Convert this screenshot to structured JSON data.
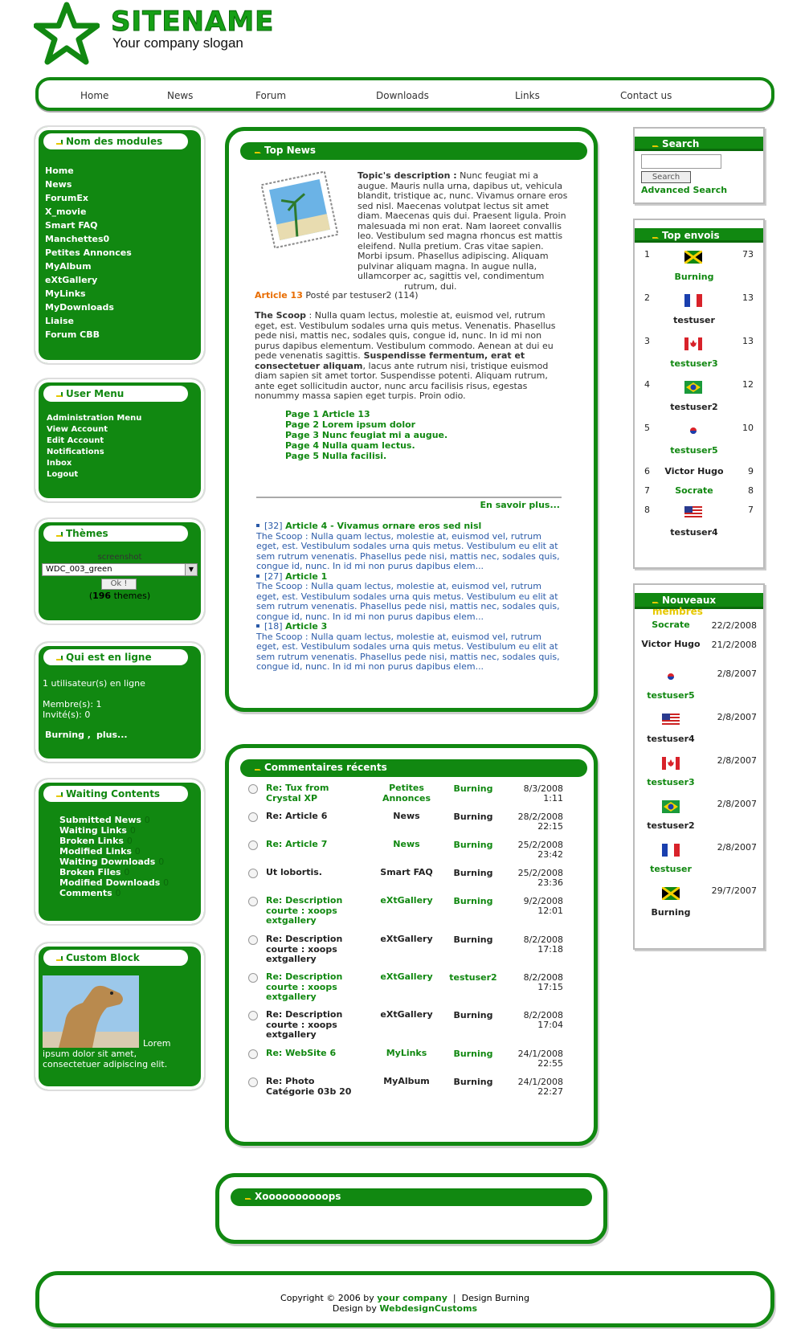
{
  "site": {
    "name": "SITENAME",
    "slogan": "Your company slogan"
  },
  "nav": [
    "Home",
    "News",
    "Forum",
    "Downloads",
    "Links",
    "Contact us"
  ],
  "modules": {
    "title": "Nom des modules",
    "items": [
      "Home",
      "News",
      "ForumEx",
      "X_movie",
      "Smart FAQ",
      "Manchettes0",
      "Petites Annonces",
      "MyAlbum",
      "eXtGallery",
      "MyLinks",
      "MyDownloads",
      "Liaise",
      "Forum CBB"
    ]
  },
  "usermenu": {
    "title": "User Menu",
    "items": [
      "Administration Menu",
      "View Account",
      "Edit Account",
      "Notifications",
      "Inbox",
      "Logout"
    ]
  },
  "themes": {
    "title": "Thèmes",
    "label": "screenshot",
    "selected": "WDC_003_green",
    "ok": "Ok !",
    "count_pre": "(",
    "count": "196",
    "count_post": " themes)"
  },
  "online": {
    "title": "Qui est en ligne",
    "users_online": "1 utilisateur(s) en ligne",
    "members": "Membre(s): 1",
    "guests": "Invité(s): 0",
    "who": "Burning ,",
    "more": "plus..."
  },
  "waiting": {
    "title": "Waiting Contents",
    "items": [
      {
        "label": "Submitted News",
        "count": "0"
      },
      {
        "label": "Waiting Links",
        "count": "0"
      },
      {
        "label": "Broken Links",
        "count": "0"
      },
      {
        "label": "Modified Links",
        "count": "0"
      },
      {
        "label": "Waiting Downloads",
        "count": "0"
      },
      {
        "label": "Broken Files",
        "count": "0"
      },
      {
        "label": "Modified Downloads",
        "count": "0"
      },
      {
        "label": "Comments",
        "count": "0"
      }
    ]
  },
  "custom": {
    "title": "Custom Block",
    "text1": "Lorem",
    "text2": "ipsum dolor sit amet,",
    "text3": "consectetuer adipiscing elit."
  },
  "topnews": {
    "title": "Top News",
    "desc_label": "Topic's description :",
    "desc": [
      " Nunc feugiat mi a",
      "augue. Mauris nulla urna, dapibus ut, vehicula",
      "blandit, tristique ac, nunc. Vivamus ornare eros",
      "sed nisl. Maecenas volutpat lectus sit amet",
      "diam. Maecenas quis dui. Praesent ligula. Proin",
      "malesuada mi non erat. Nam laoreet convallis",
      "leo. Vestibulum sed magna rhoncus est mattis",
      "eleifend. Nulla pretium. Cras vitae sapien.",
      "Morbi ipsum. Phasellus adipiscing. Aliquam",
      "pulvinar aliquam magna. In augue nulla,",
      "ullamcorper ac, sagittis vel, condimentum",
      "rutrum, dui."
    ],
    "article": "Article 13",
    "posted": "Posté par testuser2 (114)",
    "scoop_label": "The Scoop",
    "scoop": [
      " : Nulla quam lectus, molestie at, euismod vel, rutrum",
      "eget, est. Vestibulum sodales urna quis metus. Venenatis. Phasellus",
      "pede nisi, mattis nec, sodales quis, congue id, nunc. In id mi non",
      "purus dapibus elementum. Vestibulum commodo. Aenean at dui eu",
      "pede venenatis sagittis."
    ],
    "scoop_bold1": " Suspendisse fermentum, erat et",
    "scoop_bold2": "consectetuer aliquam",
    "scoop_rest": [
      ", lacus ante rutrum nisi, tristique euismod",
      "diam sapien sit amet tortor. Suspendisse potenti. Aliquam rutrum,",
      "ante eget sollicitudin auctor, nunc arcu facilisis risus, egestas",
      "nonummy massa sapien eget turpis. Proin odio."
    ],
    "pages": [
      "Page 1 Article 13",
      "Page 2 Lorem ipsum dolor",
      "Page 3 Nunc feugiat mi a augue.",
      "Page 4 Nulla quam lectus.",
      "Page 5 Nulla facilisi."
    ],
    "more": "En savoir plus...",
    "items": [
      {
        "num": "[32]",
        "title": "Article 4 - Vivamus ornare eros sed nisl",
        "lines": [
          "The Scoop : Nulla quam lectus, molestie at, euismod vel, rutrum",
          "eget, est. Vestibulum sodales urna quis metus. Vestibulum eu elit at",
          "sem rutrum venenatis. Phasellus pede nisi, mattis nec, sodales quis,",
          "congue id, nunc. In id mi non purus dapibus elem..."
        ]
      },
      {
        "num": "[27]",
        "title": "Article 1",
        "lines": [
          "The Scoop : Nulla quam lectus, molestie at, euismod vel, rutrum",
          "eget, est. Vestibulum sodales urna quis metus. Vestibulum eu elit at",
          "sem rutrum venenatis. Phasellus pede nisi, mattis nec, sodales quis,",
          "congue id, nunc. In id mi non purus dapibus elem..."
        ]
      },
      {
        "num": "[18]",
        "title": "Article 3",
        "lines": [
          "The Scoop : Nulla quam lectus, molestie at, euismod vel, rutrum",
          "eget, est. Vestibulum sodales urna quis metus. Vestibulum eu elit at",
          "sem rutrum venenatis. Phasellus pede nisi, mattis nec, sodales quis,",
          "congue id, nunc. In id mi non purus dapibus elem..."
        ]
      }
    ]
  },
  "comments": {
    "title": "Commentaires récents",
    "rows": [
      {
        "subject": "Re: Tux from Crystal XP",
        "subject2": "",
        "module": "Petites Annonces",
        "user": "Burning",
        "date": "8/3/2008",
        "time": "1:11",
        "link": true
      },
      {
        "subject": "Re: Article 6",
        "subject2": "",
        "module": "News",
        "user": "Burning",
        "date": "28/2/2008",
        "time": "22:15",
        "link": false
      },
      {
        "subject": "Re: Article 7",
        "subject2": "",
        "module": "News",
        "user": "Burning",
        "date": "25/2/2008",
        "time": "23:42",
        "link": true
      },
      {
        "subject": "Ut lobortis.",
        "subject2": "",
        "module": "Smart FAQ",
        "user": "Burning",
        "date": "25/2/2008",
        "time": "23:36",
        "link": false
      },
      {
        "subject": "Re: Description courte : xoops extgallery",
        "subject2": "",
        "module": "eXtGallery",
        "user": "Burning",
        "date": "9/2/2008",
        "time": "12:01",
        "link": true
      },
      {
        "subject": "Re: Description courte : xoops extgallery",
        "subject2": "",
        "module": "eXtGallery",
        "user": "Burning",
        "date": "8/2/2008",
        "time": "17:18",
        "link": false
      },
      {
        "subject": "Re: Description courte : xoops extgallery",
        "subject2": "",
        "module": "eXtGallery",
        "user": "testuser2",
        "date": "8/2/2008",
        "time": "17:15",
        "link": true
      },
      {
        "subject": "Re: Description courte : xoops extgallery",
        "subject2": "",
        "module": "eXtGallery",
        "user": "Burning",
        "date": "8/2/2008",
        "time": "17:04",
        "link": false
      },
      {
        "subject": "Re: WebSite 6",
        "subject2": "",
        "module": "MyLinks",
        "user": "Burning",
        "date": "24/1/2008",
        "time": "22:55",
        "link": true
      },
      {
        "subject": "Re: Photo Catégorie 03b 20",
        "subject2": "",
        "module": "MyAlbum",
        "user": "Burning",
        "date": "24/1/2008",
        "time": "22:27",
        "link": false
      }
    ]
  },
  "xoops": {
    "title": "Xoooooooooops"
  },
  "search": {
    "title": "Search",
    "value": "",
    "button": "Search",
    "advanced": "Advanced Search"
  },
  "topenvois": {
    "title": "Top envois",
    "rows": [
      {
        "rank": "1",
        "name": "Burning",
        "count": "73",
        "flag": "jamaica"
      },
      {
        "rank": "2",
        "name": "testuser",
        "count": "13",
        "flag": "france"
      },
      {
        "rank": "3",
        "name": "testuser3",
        "count": "13",
        "flag": "canada"
      },
      {
        "rank": "4",
        "name": "testuser2",
        "count": "12",
        "flag": "brazil"
      },
      {
        "rank": "5",
        "name": "testuser5",
        "count": "10",
        "flag": "korea"
      },
      {
        "rank": "6",
        "name": "Victor Hugo",
        "count": "9",
        "flag": ""
      },
      {
        "rank": "7",
        "name": "Socrate",
        "count": "8",
        "flag": ""
      },
      {
        "rank": "8",
        "name": "testuser4",
        "count": "7",
        "flag": "usa"
      }
    ]
  },
  "nouveaux": {
    "title": "Nouveaux",
    "title2": "membres",
    "rows": [
      {
        "name": "Socrate",
        "date": "22/2/2008",
        "flag": ""
      },
      {
        "name": "Victor Hugo",
        "date": "21/2/2008",
        "flag": ""
      },
      {
        "name": "testuser5",
        "date": "2/8/2007",
        "flag": "korea"
      },
      {
        "name": "testuser4",
        "date": "2/8/2007",
        "flag": "usa"
      },
      {
        "name": "testuser3",
        "date": "2/8/2007",
        "flag": "canada"
      },
      {
        "name": "testuser2",
        "date": "2/8/2007",
        "flag": "brazil"
      },
      {
        "name": "testuser",
        "date": "2/8/2007",
        "flag": "france"
      },
      {
        "name": "Burning",
        "date": "29/7/2007",
        "flag": "jamaica"
      }
    ]
  },
  "footer": {
    "copyright": "Copyright © 2006 by",
    "company": "your company",
    "sep": "|",
    "design": "Design Burning",
    "design_by": "Design by",
    "designer": "WebdesignCustoms"
  },
  "colors": {
    "accent": "#118811",
    "highlight": "#e6c800",
    "article_orange": "#e86c00",
    "news_blue": "#2a5aa8"
  }
}
